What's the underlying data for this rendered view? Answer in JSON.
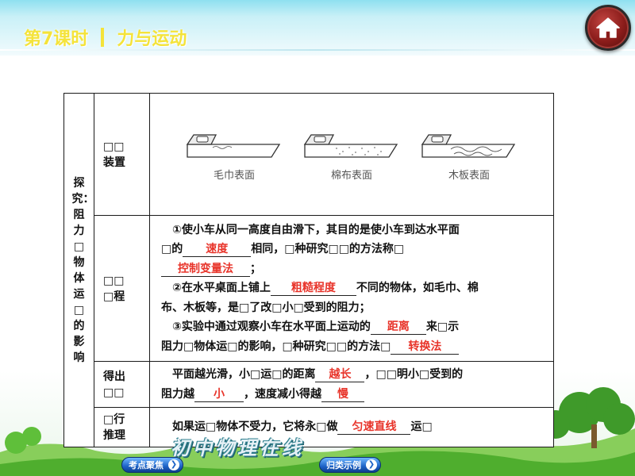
{
  "header": {
    "lesson": "第7课时",
    "title": "力与运动",
    "home_icon": "home-icon"
  },
  "table": {
    "topic": "探究：阻力□物体运□的影响",
    "rows": {
      "apparatus": {
        "label_line1": "□□",
        "label_line2": "装置",
        "surfaces": [
          "毛巾表面",
          "棉布表面",
          "木板表面"
        ]
      },
      "process": {
        "label_line1": "□□",
        "label_line2": "□程",
        "line1": "①使小车从同一高度自由滑下，其目的是使小车到达水平面",
        "line2_pre": "□的",
        "ans_speed": "速度",
        "line2_post": "相同，□种研究□□的方法称□",
        "ans_control": "控制变量法",
        "line3_post": "；",
        "line4_pre": "②在水平桌面上铺上",
        "ans_rough": "粗糙程度",
        "line4_post": "不同的物体，如毛巾、棉",
        "line5": "布、木板等，是□了改□小□受到的阻力；",
        "line6_pre": "③实验中通过观察小车在水平面上运动的",
        "ans_distance": "距离",
        "line6_post": "来□示",
        "line7_pre": "阻力□物体运□的影响，□种研究□□的方法□",
        "ans_conversion": "转换法"
      },
      "conclusion": {
        "label_line1": "得出",
        "label_line2": "□□",
        "line1_pre": "平面越光滑，小□运□的距离",
        "ans_longer": "越长",
        "line1_post": "，□□明小□受到的",
        "line2_pre": "阻力越",
        "ans_smaller": "小",
        "line2_mid": "，速度减小得越",
        "ans_slower": "慢"
      },
      "inference": {
        "label_line1": "□行",
        "label_line2": "推理",
        "line_pre": "如果运□物体不受力，它将永□做",
        "ans_uniform": "匀速直线",
        "line_post": "运□"
      }
    }
  },
  "footer": {
    "nav_left": "考点聚焦",
    "nav_right": "归类示例",
    "watermark": "初中物理在线"
  },
  "colors": {
    "answer": "#e8342a",
    "title": "#f4e33a",
    "nav": "#1d63c7"
  }
}
